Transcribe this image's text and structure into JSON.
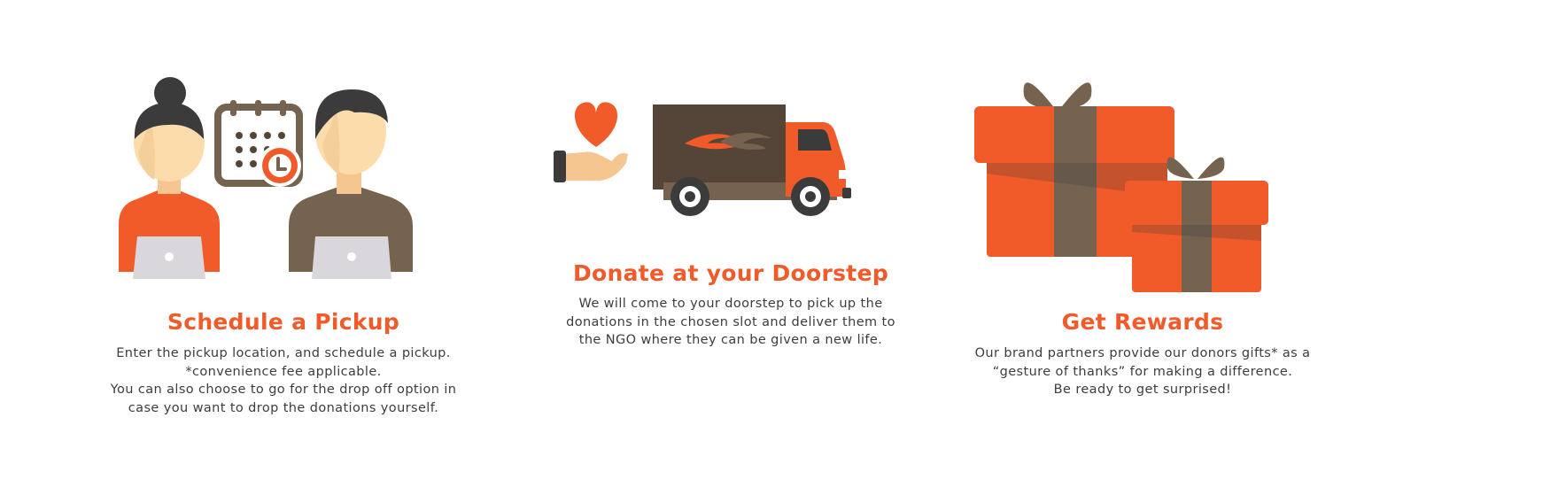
{
  "steps": [
    {
      "title": "Schedule a Pickup",
      "lines": [
        "Enter the pickup location, and schedule a pickup.",
        "*convenience fee applicable.",
        "You can also choose to go for the drop off option in",
        "case you want to drop the donations yourself."
      ],
      "icon": "people-laptop-calendar-icon"
    },
    {
      "title": "Donate at your Doorstep",
      "lines": [
        "We will come to your doorstep to pick up the",
        "donations in the chosen slot and deliver them to",
        "the NGO where they can be given a new life."
      ],
      "icon": "heart-hand-truck-icon"
    },
    {
      "title": "Get Rewards",
      "lines": [
        "Our brand partners provide our donors gifts* as a",
        "“gesture of thanks” for making a difference.",
        "Be ready to get surprised!"
      ],
      "icon": "gift-boxes-icon"
    }
  ],
  "colors": {
    "accent": "#f15a29",
    "brown": "#75624f",
    "dark_brown": "#554538",
    "skin": "#fddcac",
    "hair": "#3b3b3b",
    "laptop": "#d9d7db",
    "text": "#3d3d3d"
  }
}
